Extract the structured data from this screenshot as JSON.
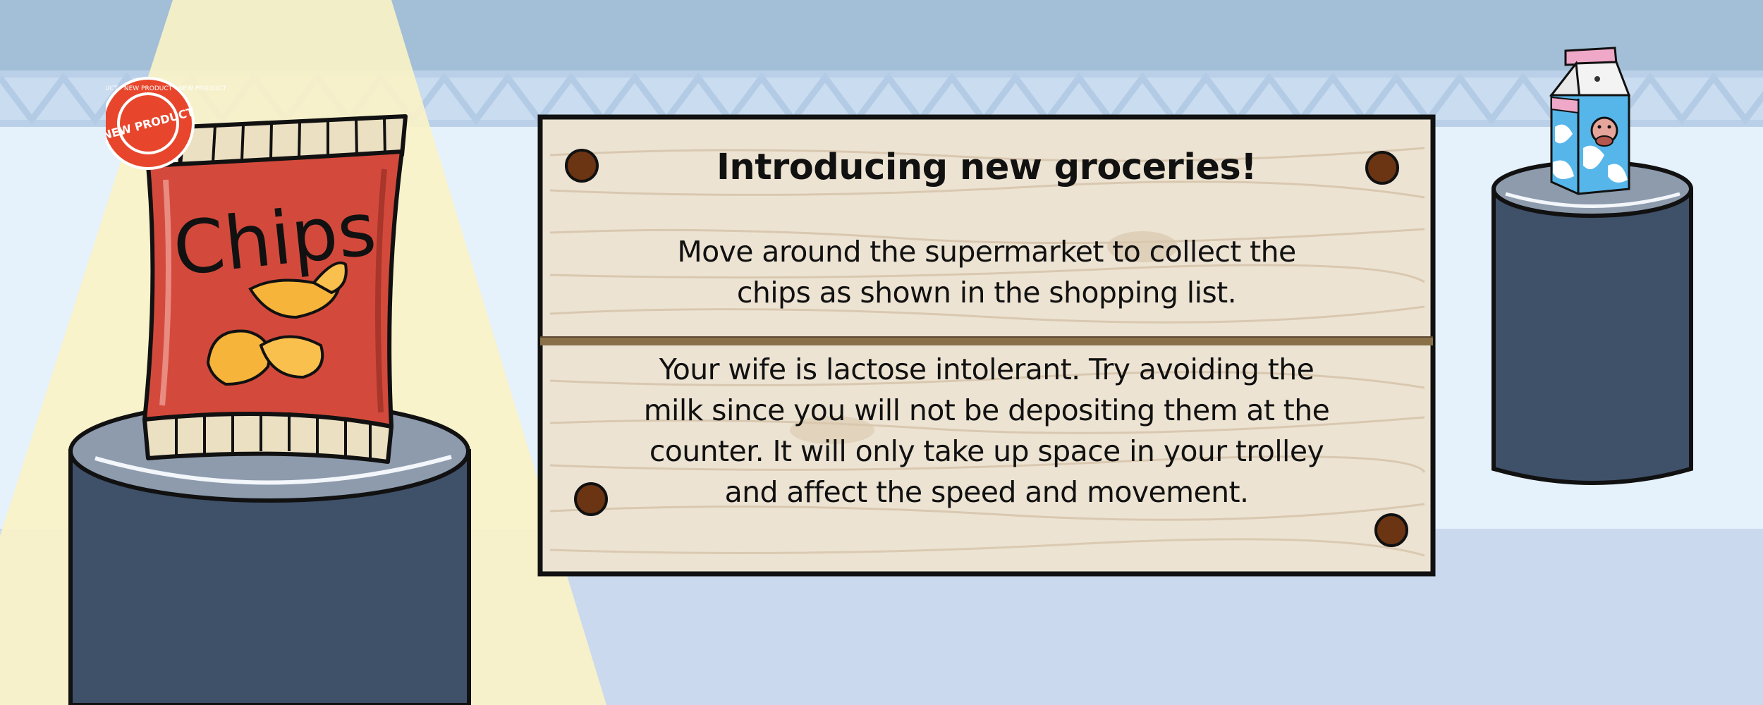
{
  "sign": {
    "title": "Introducing new groceries!",
    "paragraph_1": "Move around the supermarket to collect the chips as shown in the shopping list.",
    "paragraph_2": "Your wife is lactose intolerant. Try avoiding the milk since you will not be depositing them at the counter. It will only take up space in your trolley and affect the speed and movement."
  },
  "chips_bag": {
    "label": "Chips",
    "badge_text": "NEW PRODUCT",
    "badge_ring_text": "NEW PRODUCT · NEW PRODUCT · NEW PRODUCT"
  },
  "milk_carton": {
    "icon": "milk-carton-icon"
  },
  "colors": {
    "wall": "#a3bfd7",
    "floor": "#cad9ee",
    "pedestal": "#3f5069",
    "chips_bag": "#d34a3c",
    "sign_wood": "#ede3d3",
    "badge": "#e8462c"
  }
}
